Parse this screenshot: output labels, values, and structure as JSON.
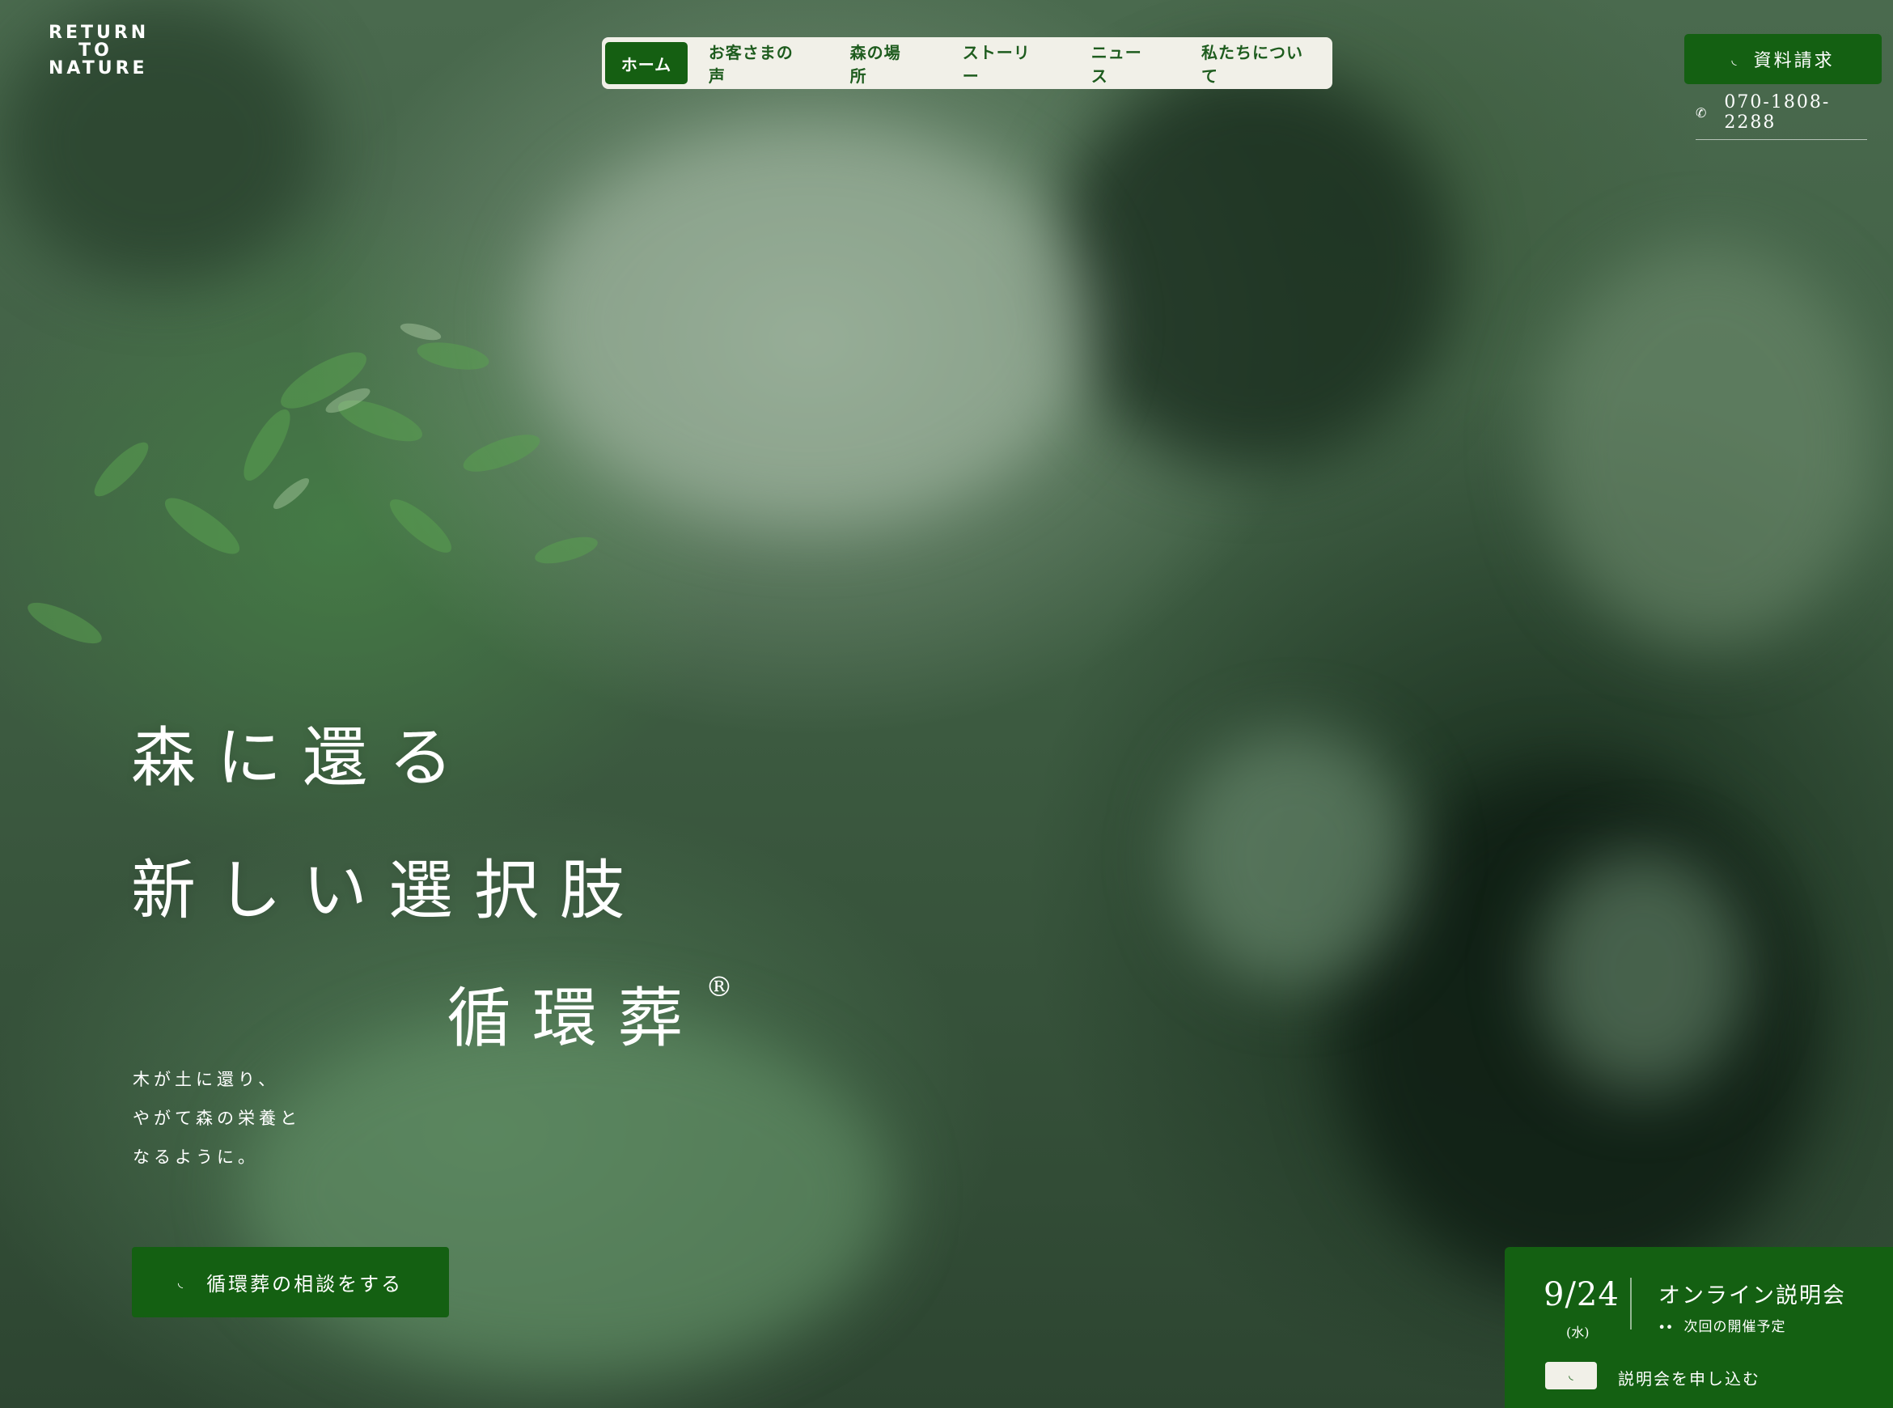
{
  "logo": {
    "line1": "RETURN",
    "line2": "TO",
    "line3": "NATURE"
  },
  "nav": {
    "items": [
      "ホーム",
      "お客さまの声",
      "森の場所",
      "ストーリー",
      "ニュース",
      "私たちについて"
    ],
    "active_index": 0
  },
  "header": {
    "request_label": "資料請求",
    "phone": "070-1808-2288"
  },
  "hero": {
    "line1": "森に還る",
    "line2": "新しい選択肢",
    "line3": "循環葬",
    "registered": "®",
    "sub1": "木が土に還り、",
    "sub2": "やがて森の栄養と",
    "sub3": "なるように。",
    "consult_label": "循環葬の相談をする"
  },
  "seminar": {
    "date": "9/24",
    "weekday": "(水)",
    "title": "オンライン説明会",
    "subtitle": "次回の開催予定",
    "apply_label": "説明会を申し込む"
  },
  "colors": {
    "brand_green": "#146012",
    "nav_bg": "#f1f0e8",
    "text_light": "#ffffff"
  }
}
